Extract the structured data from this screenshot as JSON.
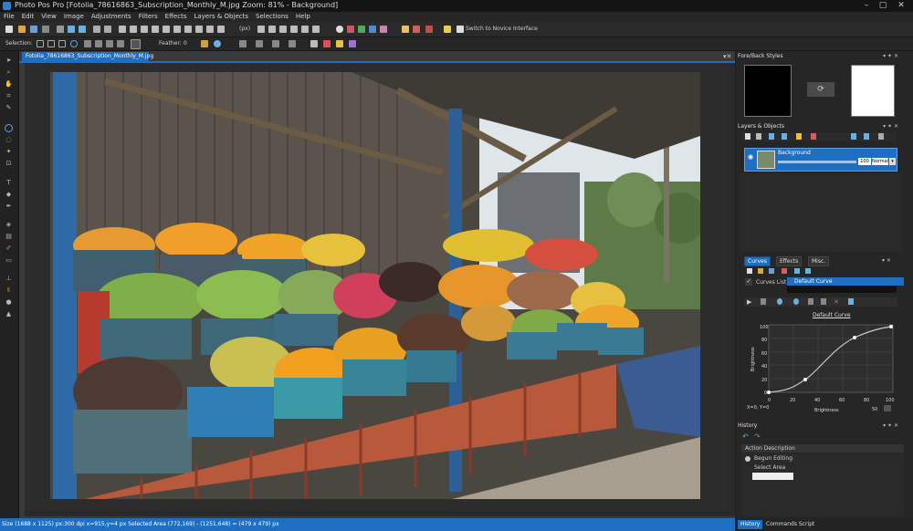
{
  "app": {
    "window_title": "Photo Pos Pro [Fotolia_78616863_Subscription_Monthly_M.jpg Zoom: 81% - Background]",
    "window_buttons": [
      "–",
      "▢",
      "✕"
    ]
  },
  "menu": [
    "File",
    "Edit",
    "View",
    "Image",
    "Adjustments",
    "Filters",
    "Effects",
    "Layers & Objects",
    "Selections",
    "Help"
  ],
  "toolbar": {
    "zoom_value": "(px)",
    "novice_label": "Switch to Novice Interface"
  },
  "options_bar": {
    "selection_label": "Selection:",
    "feather_label": "Feather:",
    "feather_value": "0"
  },
  "document": {
    "tab_label": "Fotolia_78616863_Subscription_Monthly_M.jpg"
  },
  "status": {
    "text": "Size (1688 x 1125) px:300 dpi    x=915,y=4 px    Selected Area (772,169) - (1251,648) = (479 x 479) px"
  },
  "panels": {
    "fore_back": {
      "title": "Fore/Back Styles",
      "fore_color": "#000000",
      "back_color": "#ffffff"
    },
    "layers": {
      "title": "Layers & Objects",
      "layer_name": "Background",
      "opacity": "100",
      "blend_mode": "Normal"
    },
    "adjust_tabs": [
      "Curves",
      "Effects",
      "Misc."
    ],
    "curves": {
      "list_label": "Curves List:",
      "list_value": "Default Curve",
      "graph_title": "Default Curve",
      "y_label": "Brightness",
      "x_label": "Brightness",
      "y_ticks": [
        "100",
        "80",
        "60",
        "40",
        "20",
        "0"
      ],
      "x_ticks": [
        "0",
        "20",
        "40",
        "60",
        "80",
        "100"
      ],
      "readout": "X=0, Y=0",
      "spin_value": "50"
    },
    "history": {
      "title": "History",
      "column": "Action Description",
      "items": [
        "Begun Editing",
        "Select Area"
      ]
    },
    "bottom_tabs": [
      "History",
      "Commands Script"
    ]
  },
  "colors": {
    "accent": "#1e6fc2",
    "panel_bg": "#262626",
    "dark_bg": "#1e1e1e"
  }
}
